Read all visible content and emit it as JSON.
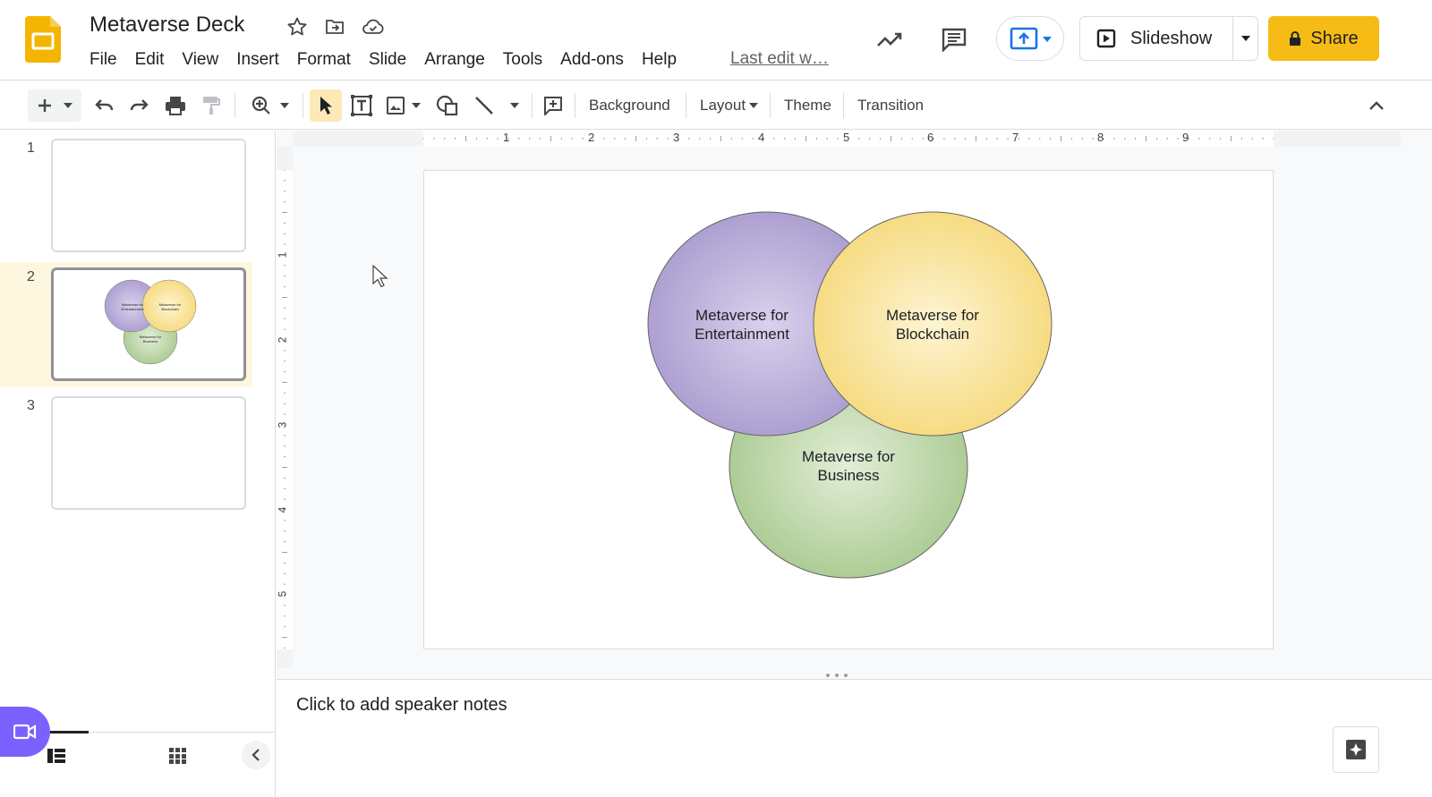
{
  "app": {
    "title": "Metaverse Deck",
    "last_edit": "Last edit w…"
  },
  "menu": [
    "File",
    "Edit",
    "View",
    "Insert",
    "Format",
    "Slide",
    "Arrange",
    "Tools",
    "Add-ons",
    "Help"
  ],
  "header": {
    "slideshow_label": "Slideshow",
    "share_label": "Share"
  },
  "toolbar": {
    "background_label": "Background",
    "layout_label": "Layout",
    "theme_label": "Theme",
    "transition_label": "Transition"
  },
  "rulers": {
    "horizontal_ticks": [
      "1",
      "2",
      "3",
      "4",
      "5",
      "6",
      "7",
      "8",
      "9"
    ],
    "vertical_ticks": [
      "1",
      "2",
      "3",
      "4",
      "5"
    ]
  },
  "filmstrip": {
    "slides": [
      {
        "number": "1"
      },
      {
        "number": "2"
      },
      {
        "number": "3"
      }
    ],
    "selected": "2"
  },
  "slide": {
    "circles": [
      {
        "label_line1": "Metaverse for",
        "label_line2": "Entertainment",
        "color": "#a99bcf"
      },
      {
        "label_line1": "Metaverse for",
        "label_line2": "Blockchain",
        "color": "#f6d97b"
      },
      {
        "label_line1": "Metaverse for",
        "label_line2": "Business",
        "color": "#a8c98f"
      }
    ],
    "thumb_labels": {
      "entertainment": "Metaverse for Entertainment",
      "blockchain": "Metaverse for Blockchain",
      "business": "Metaverse for Business"
    }
  },
  "notes": {
    "placeholder": "Click to add speaker notes"
  },
  "colors": {
    "accent": "#f6bb15",
    "meet": "#7b61ff",
    "selection_bg": "#fef7e0"
  }
}
